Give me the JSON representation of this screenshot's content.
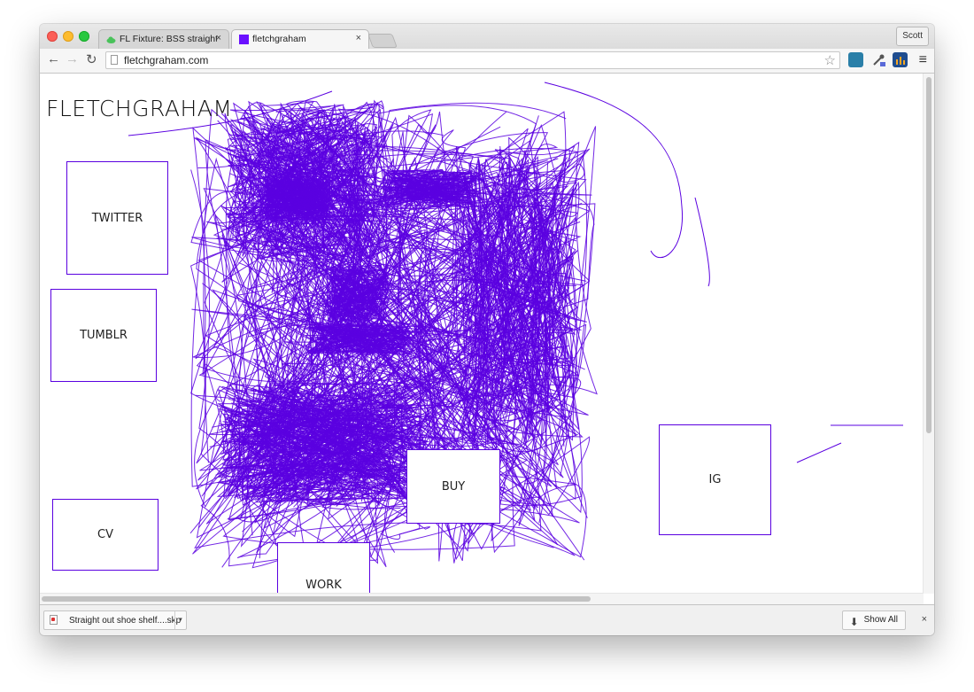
{
  "browser": {
    "tabs": [
      {
        "label": "FL Fixture: BSS straight out",
        "favicon": "cloud-icon",
        "favicon_color": "#49c25a"
      },
      {
        "label": "fletchgraham",
        "favicon": "purple-square-icon",
        "favicon_color": "#6a10ff"
      }
    ],
    "profile_name": "Scott",
    "address": "fletchgraham.com"
  },
  "page": {
    "site_title": "FLETCHGRAHAM",
    "accent_color": "#5a00e0",
    "links": {
      "twitter": "TWITTER",
      "tumblr": "TUMBLR",
      "cv": "CV",
      "buy": "BUY",
      "ig": "IG",
      "work": "WORK"
    }
  },
  "download_bar": {
    "file_name": "Straight out shoe shelf....skp",
    "show_all": "Show All"
  },
  "icons": {
    "close": "×",
    "back": "←",
    "forward": "→",
    "reload": "↻",
    "star": "☆",
    "menu": "≡",
    "download": "⬇",
    "caret": "▾"
  }
}
